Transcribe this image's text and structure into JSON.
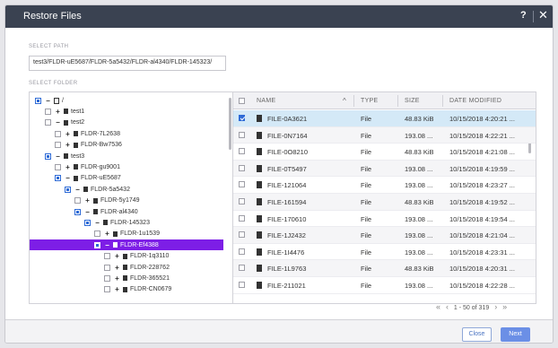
{
  "dialog": {
    "title": "Restore Files",
    "help": "?",
    "close": "✕"
  },
  "select_path": {
    "label": "SELECT PATH",
    "value": "test3/FLDR-uE5687/FLDR-5a5432/FLDR-al4340/FLDR-145323/"
  },
  "select_folder": {
    "label": "SELECT FOLDER"
  },
  "tree": [
    {
      "label": "/",
      "toggle": "−",
      "check": "partial",
      "indent": 0,
      "root": true
    },
    {
      "label": "test1",
      "toggle": "+",
      "check": "empty",
      "indent": 1
    },
    {
      "label": "test2",
      "toggle": "−",
      "check": "empty",
      "indent": 1
    },
    {
      "label": "FLDR-7L2638",
      "toggle": "+",
      "check": "empty",
      "indent": 2
    },
    {
      "label": "FLDR-Bw7536",
      "toggle": "+",
      "check": "empty",
      "indent": 2
    },
    {
      "label": "test3",
      "toggle": "−",
      "check": "partial",
      "indent": 1
    },
    {
      "label": "FLDR-gu9001",
      "toggle": "+",
      "check": "empty",
      "indent": 2
    },
    {
      "label": "FLDR-uE5687",
      "toggle": "−",
      "check": "partial",
      "indent": 2
    },
    {
      "label": "FLDR-5a5432",
      "toggle": "−",
      "check": "partial",
      "indent": 3
    },
    {
      "label": "FLDR-5y1749",
      "toggle": "+",
      "check": "empty",
      "indent": 4
    },
    {
      "label": "FLDR-al4340",
      "toggle": "−",
      "check": "partial",
      "indent": 4
    },
    {
      "label": "FLDR-145323",
      "toggle": "−",
      "check": "partial",
      "indent": 5
    },
    {
      "label": "FLDR-1u1539",
      "toggle": "+",
      "check": "empty",
      "indent": 6
    },
    {
      "label": "FLDR-Ef4388",
      "toggle": "−",
      "check": "partial",
      "indent": 6,
      "selected": true
    },
    {
      "label": "FLDR-1q3110",
      "toggle": "+",
      "check": "empty",
      "indent": 7
    },
    {
      "label": "FLDR-228762",
      "toggle": "+",
      "check": "empty",
      "indent": 7
    },
    {
      "label": "FLDR-365521",
      "toggle": "+",
      "check": "empty",
      "indent": 7
    },
    {
      "label": "FLDR-CN0679",
      "toggle": "+",
      "check": "empty",
      "indent": 7
    }
  ],
  "grid": {
    "columns": {
      "name": "NAME",
      "type": "TYPE",
      "size": "SIZE",
      "date": "DATE MODIFIED"
    },
    "sort_icon": "^",
    "rows": [
      {
        "name": "FILE-0A3621",
        "type": "File",
        "size": "48.83 KiB",
        "date": "10/15/2018 4:20:21 ...",
        "checked": true
      },
      {
        "name": "FILE-0N7164",
        "type": "File",
        "size": "193.08 ...",
        "date": "10/15/2018 4:22:21 ..."
      },
      {
        "name": "FILE-0O8210",
        "type": "File",
        "size": "48.83 KiB",
        "date": "10/15/2018 4:21:08 ..."
      },
      {
        "name": "FILE-0T5497",
        "type": "File",
        "size": "193.08 ...",
        "date": "10/15/2018 4:19:59 ..."
      },
      {
        "name": "FILE-121064",
        "type": "File",
        "size": "193.08 ...",
        "date": "10/15/2018 4:23:27 ..."
      },
      {
        "name": "FILE-161594",
        "type": "File",
        "size": "48.83 KiB",
        "date": "10/15/2018 4:19:52 ..."
      },
      {
        "name": "FILE-170610",
        "type": "File",
        "size": "193.08 ...",
        "date": "10/15/2018 4:19:54 ..."
      },
      {
        "name": "FILE-1J2432",
        "type": "File",
        "size": "193.08 ...",
        "date": "10/15/2018 4:21:04 ..."
      },
      {
        "name": "FILE-1I4476",
        "type": "File",
        "size": "193.08 ...",
        "date": "10/15/2018 4:23:31 ..."
      },
      {
        "name": "FILE-1L9763",
        "type": "File",
        "size": "48.83 KiB",
        "date": "10/15/2018 4:20:31 ..."
      },
      {
        "name": "FILE-211021",
        "type": "File",
        "size": "193.08 ...",
        "date": "10/15/2018 4:22:28 ..."
      }
    ]
  },
  "pager": {
    "first": "«",
    "prev": "‹",
    "range": "1 - 50 of 319",
    "next": "›",
    "last": "»"
  },
  "buttons": {
    "close": "Close",
    "next": "Next"
  }
}
